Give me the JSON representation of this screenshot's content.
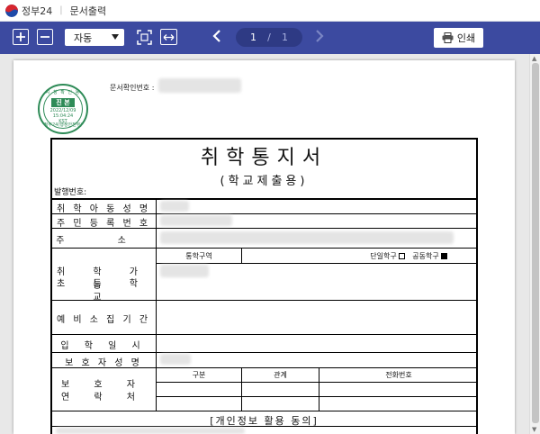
{
  "titlebar": {
    "app_name": "정부24",
    "doc_label": "문서출력"
  },
  "toolbar": {
    "zoom_mode": "자동",
    "current_page": "1",
    "page_sep": "/",
    "total_pages": "1",
    "print_label": "인쇄",
    "icons": [
      "zoom-in-icon",
      "zoom-out-icon",
      "fit-page-icon",
      "fit-width-icon",
      "prev-page-icon",
      "next-page-icon",
      "printer-icon"
    ]
  },
  "document": {
    "doc_confirm_label": "문서확인번호 :",
    "stamp": {
      "top_text": "시 청 확 인 용",
      "main_text": "진 본",
      "date": "2022/12/09",
      "time": "15:04:24",
      "timezone": "KST",
      "bottom_text": "정부24(행정안전부)"
    },
    "title": "취학통지서",
    "subtitle": "(학교제출용)",
    "issue_number_label": "발행번호:",
    "rows": {
      "child_name": "취 학 아 동 성 명",
      "resident_number": "주 민 등 록 번 호",
      "address": "주 소",
      "school_line1": "취 학 가 능",
      "school_line2": "초 등 학 교",
      "school_zone_label": "통학구역",
      "single_school_label": "단일학구",
      "joint_school_label": "공동학구",
      "pre_call_period": "예 비 소 집 기 간",
      "entrance_date": "입 학 일 시",
      "guardian_name": "보 호 자 성 명",
      "guardian_contact_line1": "보 호 자",
      "guardian_contact_line2": "연 락 처",
      "col_division": "구분",
      "col_relation": "관계",
      "col_phone": "전화번호",
      "consent_heading": "[개인정보 활용 동의]"
    }
  },
  "colors": {
    "toolbar_bg": "#3c4aa0",
    "stamp_green": "#2e8b57"
  }
}
